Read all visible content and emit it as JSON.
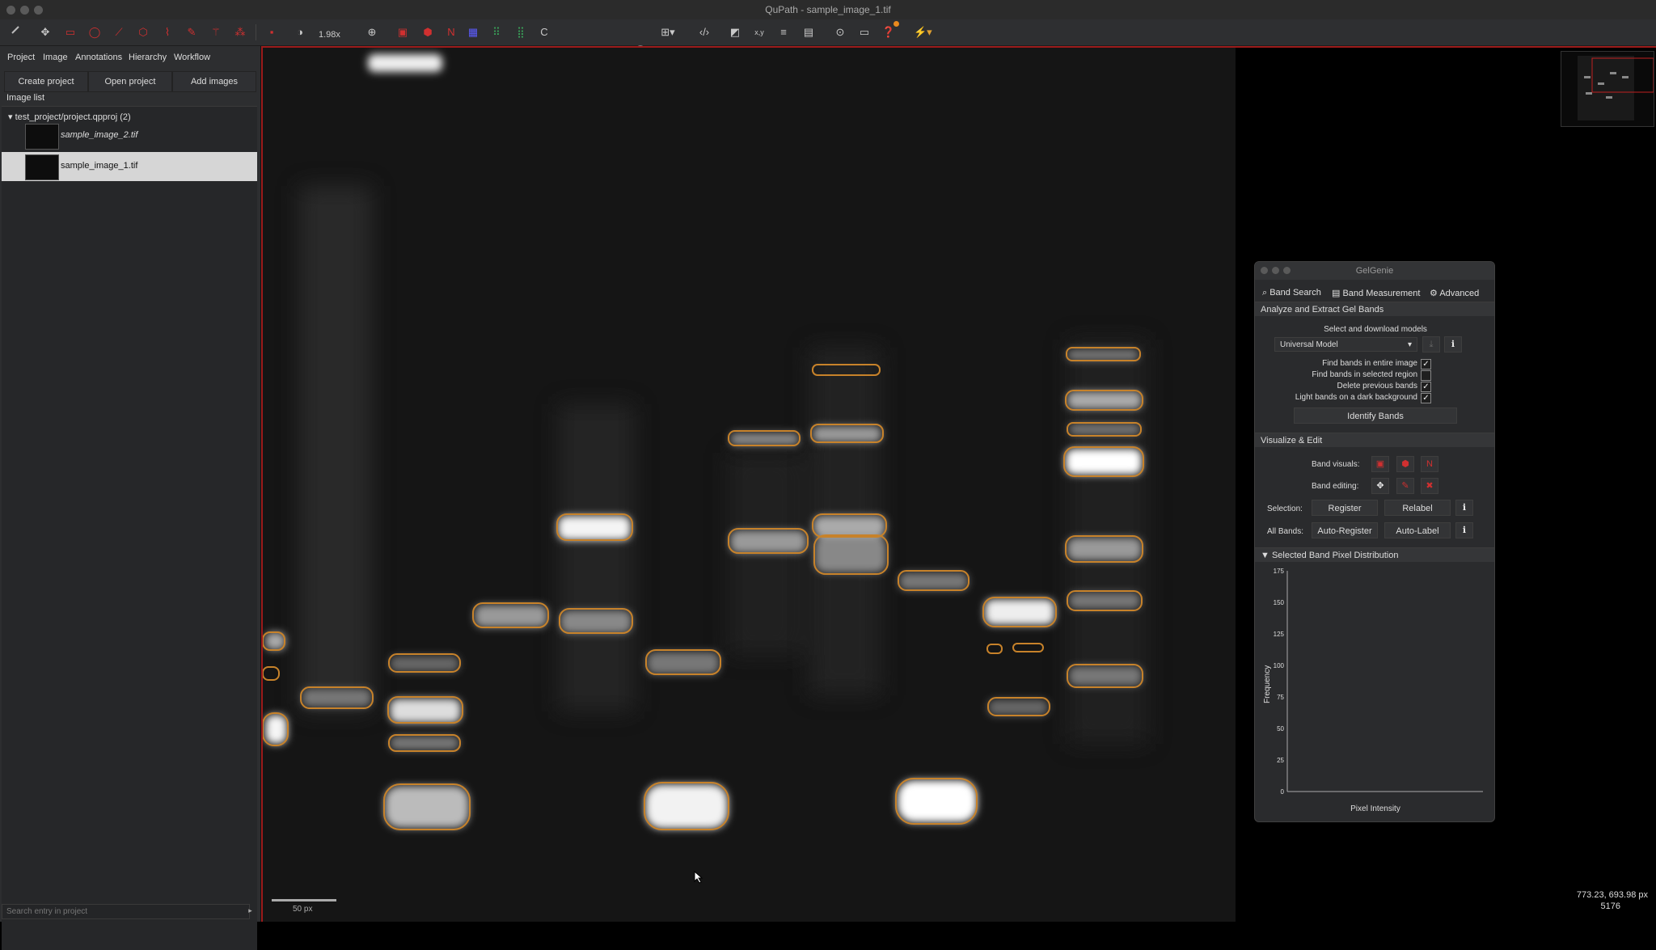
{
  "window": {
    "title": "QuPath - sample_image_1.tif"
  },
  "toolbar": {
    "zoom": "1.98x",
    "icons": [
      "move-icon",
      "pan-icon",
      "rectangle-icon",
      "ellipse-icon",
      "line-icon",
      "polygon-icon",
      "polyline-icon",
      "brush-icon",
      "wand-icon",
      "points-icon",
      "selection-mode-icon",
      "brightness-contrast-icon",
      "zoom-to-fit-icon",
      "show-annotations-icon",
      "fill-annotations-icon",
      "show-names-icon",
      "show-tma-icon",
      "show-detections-icon",
      "fill-detections-icon",
      "script-icon",
      "grid-icon",
      "overview-icon",
      "xy-icon",
      "scalebar-icon",
      "table-icon",
      "analyze-icon",
      "log-icon",
      "help-icon",
      "extension-icon"
    ],
    "letter_c": "C",
    "colors": {
      "red_tool": "#d03030",
      "green_tool": "#3aa55a",
      "notification": "#e98a1e"
    }
  },
  "left_panel": {
    "tabs": [
      "Project",
      "Image",
      "Annotations",
      "Hierarchy",
      "Workflow"
    ],
    "buttons": {
      "create_project": "Create project",
      "open_project": "Open project",
      "add_images": "Add images"
    },
    "image_list_label": "Image list",
    "project_node": "test_project/project.qpproj (2)",
    "images": [
      {
        "name": "sample_image_2.tif",
        "selected": false
      },
      {
        "name": "sample_image_1.tif",
        "selected": true
      }
    ],
    "search_placeholder": "Search entry in project"
  },
  "viewer": {
    "scalebar_label": "50 px",
    "cursor_coords": "773.23, 693.98 px",
    "pixel_value": "5176",
    "band_outline_color": "#c7822a"
  },
  "gelgenie": {
    "title": "GelGenie",
    "tabs": {
      "band_search": "Band Search",
      "band_measurement": "Band Measurement",
      "advanced": "Advanced"
    },
    "analyze_section": "Analyze and Extract Gel Bands",
    "select_models_label": "Select and download models",
    "model_selected": "Universal Model",
    "checkboxes": [
      {
        "label": "Find bands in entire image",
        "checked": true
      },
      {
        "label": "Find bands in selected region",
        "checked": false
      },
      {
        "label": "Delete previous bands",
        "checked": true
      },
      {
        "label": "Light bands on a dark background",
        "checked": true
      }
    ],
    "identify_button": "Identify Bands",
    "visualize_section": "Visualize & Edit",
    "band_visuals_label": "Band visuals:",
    "band_editing_label": "Band editing:",
    "selection_label": "Selection:",
    "register_button": "Register",
    "relabel_button": "Relabel",
    "all_bands_label": "All Bands:",
    "auto_register_button": "Auto-Register",
    "auto_label_button": "Auto-Label",
    "histogram_section": "Selected Band Pixel Distribution",
    "histogram": {
      "ylabel": "Frequency",
      "xlabel": "Pixel Intensity",
      "yticks": [
        "175",
        "150",
        "125",
        "100",
        "75",
        "50",
        "25",
        "0"
      ]
    }
  }
}
